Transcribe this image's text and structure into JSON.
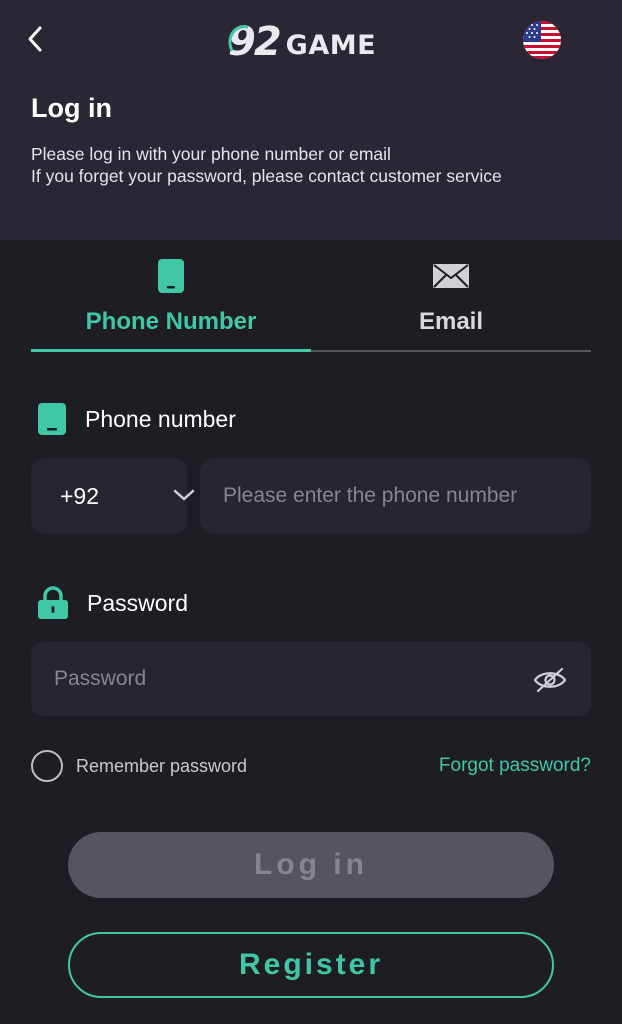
{
  "header": {
    "logo_number": "92",
    "logo_text": "GAME",
    "title": "Log in",
    "subtitle_line1": "Please log in with your phone number or email",
    "subtitle_line2": "If you forget your password, please contact customer service",
    "language_flag": "us-flag-icon"
  },
  "tabs": [
    {
      "label": "Phone Number",
      "icon": "phone-icon",
      "active": true
    },
    {
      "label": "Email",
      "icon": "email-icon",
      "active": false
    }
  ],
  "phone_field": {
    "label": "Phone number",
    "country_code": "+92",
    "placeholder": "Please enter the phone number",
    "value": ""
  },
  "password_field": {
    "label": "Password",
    "placeholder": "Password",
    "value": ""
  },
  "remember": {
    "label": "Remember password",
    "checked": false
  },
  "forgot_label": "Forgot password?",
  "login_label": "Log in",
  "register_label": "Register",
  "colors": {
    "accent": "#3fc8a2",
    "header_bg": "#2a2633",
    "page_bg": "#1d1d23",
    "input_bg": "#27252f",
    "disabled_button": "#55555f"
  }
}
